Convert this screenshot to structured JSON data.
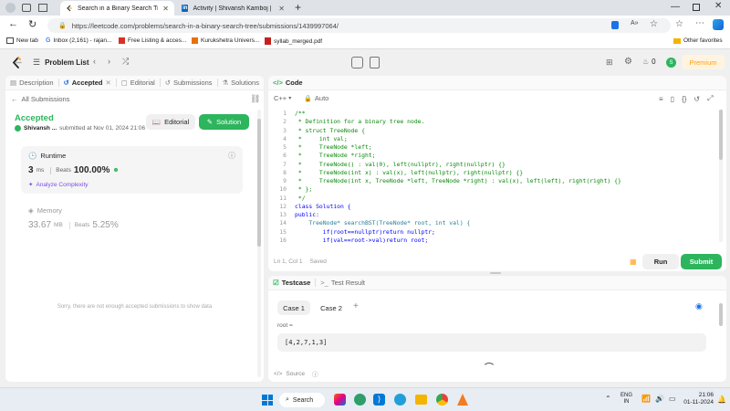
{
  "browser": {
    "tabs": [
      {
        "title": "Search in a Binary Search Tree - Le",
        "active": true
      },
      {
        "title": "Activity | Shivansh Kamboj | Linked",
        "active": false
      }
    ],
    "url": "https://leetcode.com/problems/search-in-a-binary-search-tree/submissions/1439997064/",
    "bookmarks": [
      "New tab",
      "Inbox (2,161) - rajan...",
      "Free Listing & acces...",
      "Kurukshetra Univers...",
      "syllab_merged.pdf"
    ],
    "other_favorites": "Other favorites"
  },
  "nav": {
    "problem_list": "Problem List",
    "streak": "0",
    "premium": "Premium",
    "avatar_letter": "S"
  },
  "left": {
    "tabs": [
      {
        "label": "Description"
      },
      {
        "label": "Accepted"
      },
      {
        "label": "Editorial"
      },
      {
        "label": "Submissions"
      },
      {
        "label": "Solutions"
      }
    ],
    "all_submissions": "All Submissions",
    "status": "Accepted",
    "user": "Shivansh ...",
    "submitted": "submitted at Nov 01, 2024 21:06",
    "editorial_btn": "Editorial",
    "solution_btn": "Solution",
    "runtime": {
      "label": "Runtime",
      "value": "3",
      "unit": "ms",
      "beats_label": "Beats",
      "beats": "100.00%",
      "analyze": "Analyze Complexity"
    },
    "memory": {
      "label": "Memory",
      "value": "33.67",
      "unit": "MB",
      "beats_label": "Beats",
      "beats": "5.25%"
    },
    "empty_msg": "Sorry, there are not enough accepted submissions to show data"
  },
  "code": {
    "title": "Code",
    "lang": "C++",
    "mode": "Auto",
    "status": "Ln 1, Col 1",
    "saved": "Saved",
    "run": "Run",
    "submit": "Submit",
    "lines": [
      "/**",
      " * Definition for a binary tree node.",
      " * struct TreeNode {",
      " *     int val;",
      " *     TreeNode *left;",
      " *     TreeNode *right;",
      " *     TreeNode() : val(0), left(nullptr), right(nullptr) {}",
      " *     TreeNode(int x) : val(x), left(nullptr), right(nullptr) {}",
      " *     TreeNode(int x, TreeNode *left, TreeNode *right) : val(x), left(left), right(right) {}",
      " * };",
      " */",
      "class Solution {",
      "public:",
      "    TreeNode* searchBST(TreeNode* root, int val) {",
      "        if(root==nullptr)return nullptr;",
      "        if(val==root->val)return root;"
    ]
  },
  "test": {
    "testcase_tab": "Testcase",
    "result_tab": "Test Result",
    "cases": [
      "Case 1",
      "Case 2"
    ],
    "var_label": "root =",
    "var_value": "[4,2,7,1,3]",
    "source": "Source"
  },
  "taskbar": {
    "search": "Search",
    "lang_top": "ENG",
    "lang_bottom": "IN",
    "time": "21:06",
    "date": "01-11-2024"
  },
  "colors": {
    "accent_green": "#2db55d",
    "leetcode_orange": "#ffa116",
    "premium": "#ffa116"
  }
}
